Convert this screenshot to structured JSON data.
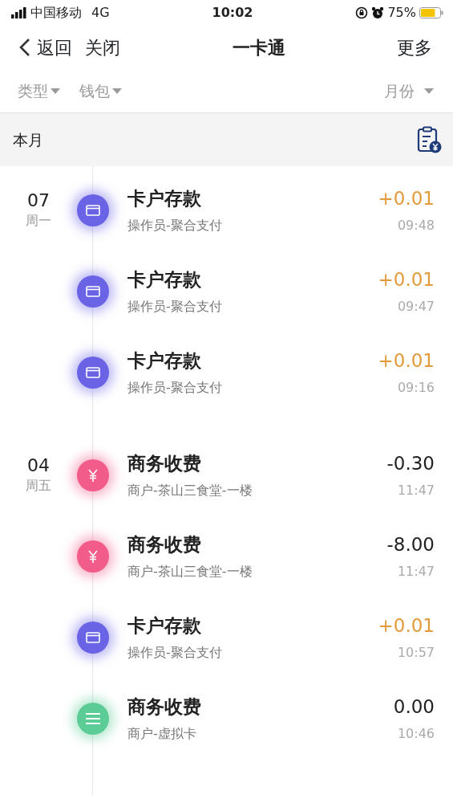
{
  "status_bar": {
    "carrier": "中国移动",
    "network": "4G",
    "time": "10:02",
    "battery": "75%"
  },
  "nav": {
    "back": "返回",
    "close": "关闭",
    "title": "一卡通",
    "more": "更多"
  },
  "filters": [
    {
      "label": "类型"
    },
    {
      "label": "钱包"
    },
    {
      "label": "月份"
    }
  ],
  "month_header": {
    "label": "本月"
  },
  "days": [
    {
      "date": "07",
      "weekday": "周一",
      "items": [
        {
          "kind": "card",
          "title": "卡户存款",
          "subtitle": "操作员-聚合支付",
          "amount": "+0.01",
          "credit": true,
          "time": "09:48"
        },
        {
          "kind": "card",
          "title": "卡户存款",
          "subtitle": "操作员-聚合支付",
          "amount": "+0.01",
          "credit": true,
          "time": "09:47"
        },
        {
          "kind": "card",
          "title": "卡户存款",
          "subtitle": "操作员-聚合支付",
          "amount": "+0.01",
          "credit": true,
          "time": "09:16"
        }
      ]
    },
    {
      "date": "04",
      "weekday": "周五",
      "items": [
        {
          "kind": "yen",
          "title": "商务收费",
          "subtitle": "商户-茶山三食堂-一楼",
          "amount": "-0.30",
          "credit": false,
          "time": "11:47"
        },
        {
          "kind": "yen",
          "title": "商务收费",
          "subtitle": "商户-茶山三食堂-一楼",
          "amount": "-8.00",
          "credit": false,
          "time": "11:47"
        },
        {
          "kind": "card",
          "title": "卡户存款",
          "subtitle": "操作员-聚合支付",
          "amount": "+0.01",
          "credit": true,
          "time": "10:57"
        },
        {
          "kind": "list",
          "title": "商务收费",
          "subtitle": "商户-虚拟卡",
          "amount": "0.00",
          "credit": false,
          "time": "10:46"
        }
      ]
    }
  ]
}
